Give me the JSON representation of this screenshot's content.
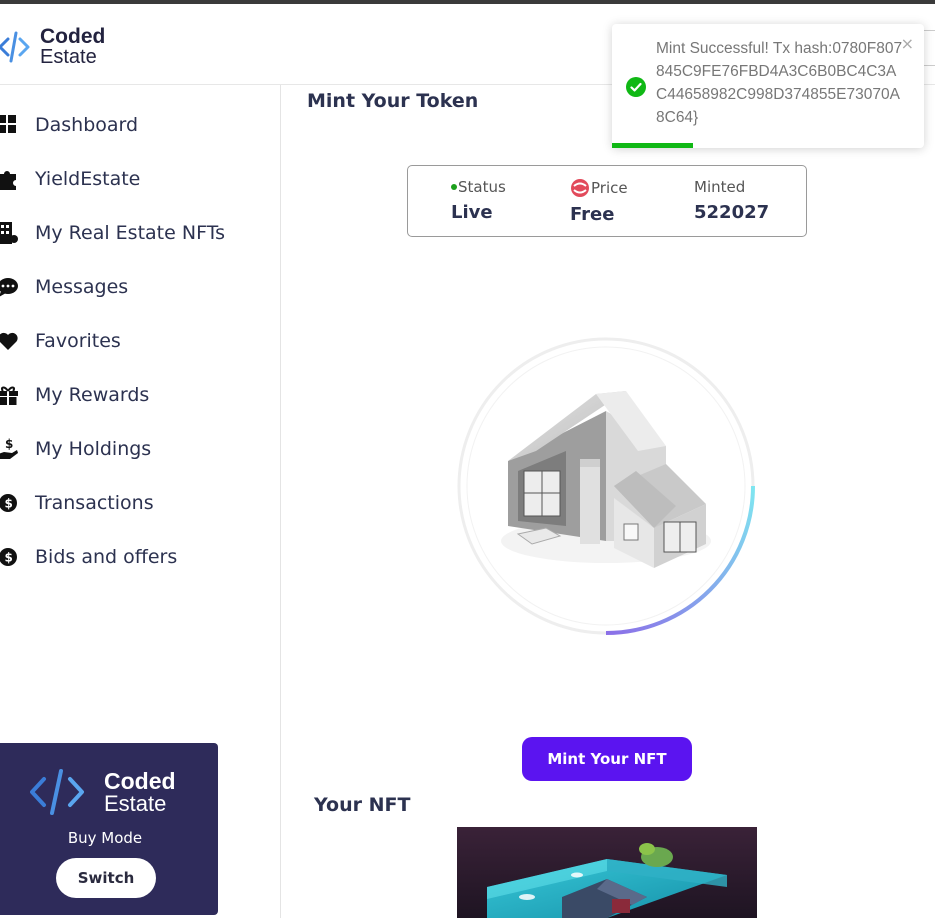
{
  "header": {
    "brand_line1": "Coded",
    "brand_line2": "Estate"
  },
  "sidebar": {
    "items": [
      {
        "label": "Dashboard",
        "icon": "dashboard-icon"
      },
      {
        "label": "YieldEstate",
        "icon": "puzzle-icon"
      },
      {
        "label": "My Real Estate NFTs",
        "icon": "building-icon"
      },
      {
        "label": "Messages",
        "icon": "chat-icon"
      },
      {
        "label": "Favorites",
        "icon": "heart-icon"
      },
      {
        "label": "My Rewards",
        "icon": "gift-icon"
      },
      {
        "label": "My Holdings",
        "icon": "hand-dollar-icon"
      },
      {
        "label": "Transactions",
        "icon": "coin-icon"
      },
      {
        "label": "Bids and offers",
        "icon": "coin-icon"
      }
    ],
    "mode_card": {
      "brand_line1": "Coded",
      "brand_line2": "Estate",
      "mode_label": "Buy Mode",
      "switch_label": "Switch"
    }
  },
  "main": {
    "title": "Mint Your Token",
    "stats": {
      "status_key": "Status",
      "status_value": "Live",
      "price_key": "Price",
      "price_value": "Free",
      "minted_key": "Minted",
      "minted_value": "522027"
    },
    "mint_button": "Mint Your NFT",
    "your_nft_title": "Your NFT"
  },
  "toast": {
    "message": "Mint Successful! Tx hash:0780F807845C9FE76FBD4A3C6B0BC4C3AC44658982C998D374855E73070A8C64}",
    "close": "×",
    "progress": 0.26
  },
  "colors": {
    "accent": "#5b14f0",
    "success": "#10b815",
    "card_bg": "#2e2b5a",
    "text": "#2c3250"
  }
}
